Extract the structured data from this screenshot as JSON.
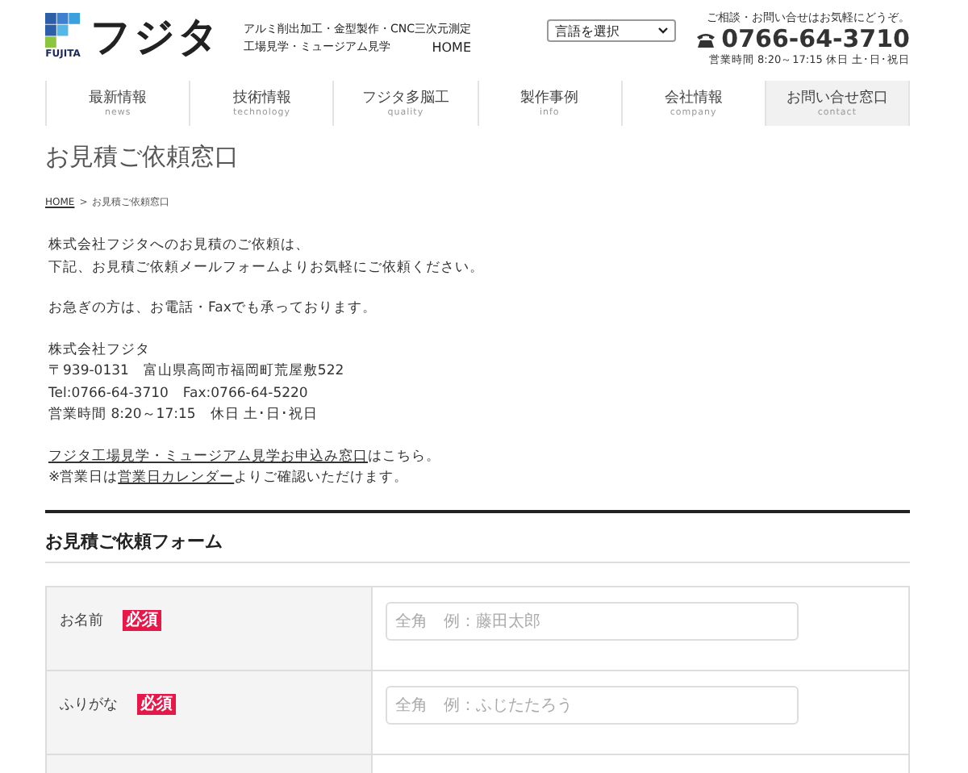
{
  "header": {
    "logo_caption": "FUJITA",
    "logo_text": "フジタ",
    "tagline_lines": [
      "アルミ削出加工・金型製作・CNC三次元測定",
      "工場見学・ミュージアム見学"
    ],
    "home_link": "HOME",
    "language_select": "言語を選択",
    "contact_note": "ご相談・お問い合せはお気軽にどうぞ。",
    "phone": "0766-64-3710",
    "hours": "営業時間 8:20～17:15 休日 土･日･祝日"
  },
  "nav": [
    {
      "label": "最新情報",
      "sub": "news",
      "selected": false
    },
    {
      "label": "技術情報",
      "sub": "technology",
      "selected": false
    },
    {
      "label": "フジタ多脳工",
      "sub": "quality",
      "selected": false
    },
    {
      "label": "製作事例",
      "sub": "info",
      "selected": false
    },
    {
      "label": "会社情報",
      "sub": "company",
      "selected": false
    },
    {
      "label": "お問い合せ窓口",
      "sub": "contact",
      "selected": true
    }
  ],
  "page_title": "お見積ご依頼窓口",
  "breadcrumb": {
    "home": "HOME",
    "separator": ">",
    "current": "お見積ご依頼窓口"
  },
  "intro": [
    {
      "kind": "lines",
      "lines": [
        "株式会社フジタへのお見積のご依頼は、",
        "下記、お見積ご依頼メールフォームよりお気軽にご依頼ください。"
      ]
    },
    {
      "kind": "lines",
      "lines": [
        "お急ぎの方は、お電話・Faxでも承っております。"
      ]
    },
    {
      "kind": "lines",
      "lines": [
        "株式会社フジタ",
        "〒939-0131　富山県高岡市福岡町荒屋敷522",
        "Tel:0766-64-3710　Fax:0766-64-5220",
        "営業時間 8:20～17:15　休日 土･日･祝日"
      ]
    },
    {
      "kind": "links",
      "lines": [
        {
          "link": "フジタ工場見学・ミュージアム見学お申込み窓口",
          "after": "はこちら。"
        },
        {
          "before": "※営業日は",
          "link": "営業日カレンダー",
          "after": "よりご確認いただけます。"
        }
      ]
    }
  ],
  "form": {
    "title": "お見積ご依頼フォーム",
    "rows": [
      {
        "label": "お名前",
        "badge": "必須",
        "placeholder": "全角　例：藤田太郎"
      },
      {
        "label": "ふりがな",
        "badge": "必須",
        "placeholder": "全角　例：ふじたたろう"
      }
    ]
  }
}
